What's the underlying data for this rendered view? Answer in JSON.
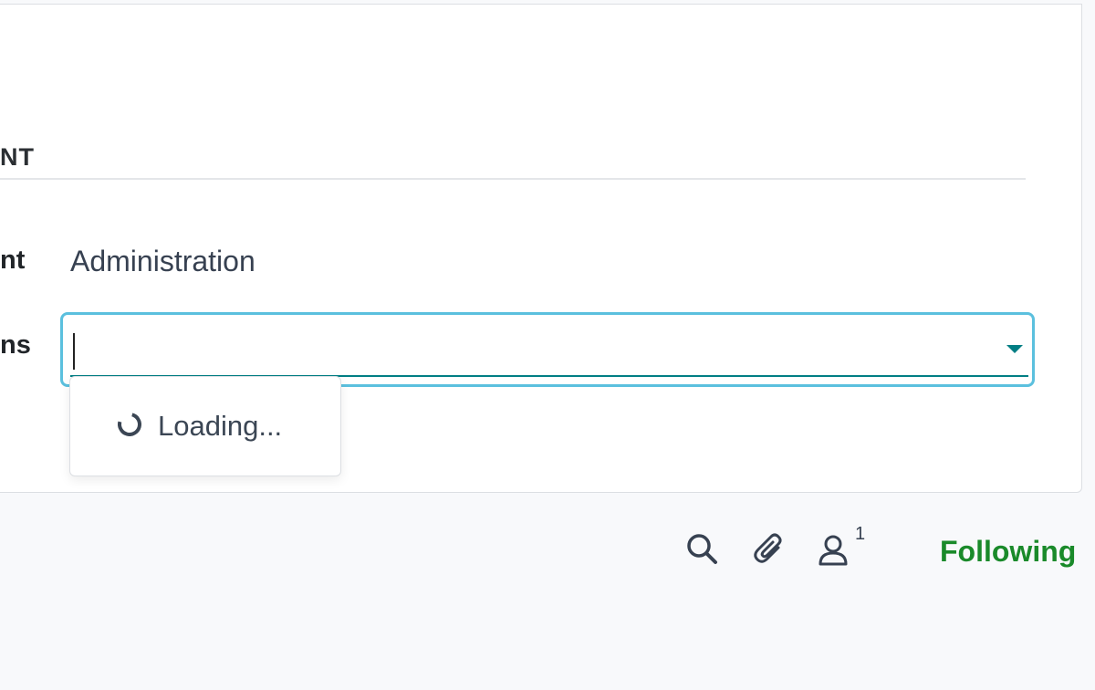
{
  "section": {
    "title": "NT"
  },
  "fields": {
    "department_label": "nt",
    "department_value": "Administration",
    "permissions_label": "ns",
    "permissions_value": "",
    "permissions_placeholder": ""
  },
  "dropdown": {
    "loading_text": "Loading..."
  },
  "chatter": {
    "search_icon": "search-icon",
    "attach_icon": "paperclip-icon",
    "follower_icon": "user-icon",
    "follower_count": "1",
    "following_label": "Following"
  },
  "colors": {
    "focus_border": "#5bc0de",
    "accent": "#017e84",
    "following": "#1a8a2a"
  }
}
